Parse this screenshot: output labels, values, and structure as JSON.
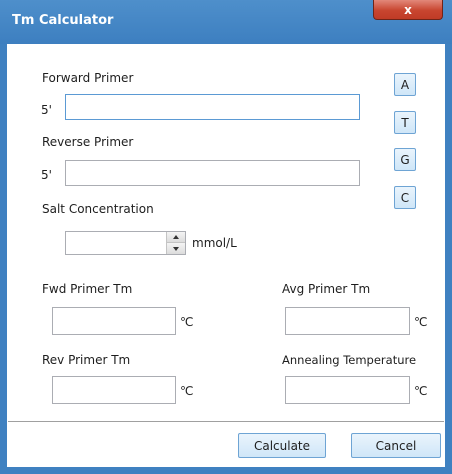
{
  "window": {
    "title": "Tm Calculator",
    "close_glyph": "x"
  },
  "forward_primer": {
    "label": "Forward Primer",
    "prefix": "5'",
    "value": ""
  },
  "reverse_primer": {
    "label": "Reverse Primer",
    "prefix": "5'",
    "value": ""
  },
  "bases": [
    "A",
    "T",
    "G",
    "C"
  ],
  "salt": {
    "label": "Salt Concentration",
    "value": "",
    "unit": "mmol/L"
  },
  "results": {
    "fwd_tm": {
      "label": "Fwd Primer Tm",
      "value": "",
      "unit": "℃"
    },
    "avg_tm": {
      "label": "Avg Primer Tm",
      "value": "",
      "unit": "℃"
    },
    "rev_tm": {
      "label": "Rev Primer Tm",
      "value": "",
      "unit": "℃"
    },
    "annealing": {
      "label": "Annealing Temperature",
      "value": "",
      "unit": "℃"
    }
  },
  "actions": {
    "calculate": "Calculate",
    "cancel": "Cancel"
  },
  "colors": {
    "titlebar": "#3f81c1",
    "close": "#c8452f",
    "button_border": "#6ea4d4",
    "focus_border": "#5b9ad4"
  }
}
